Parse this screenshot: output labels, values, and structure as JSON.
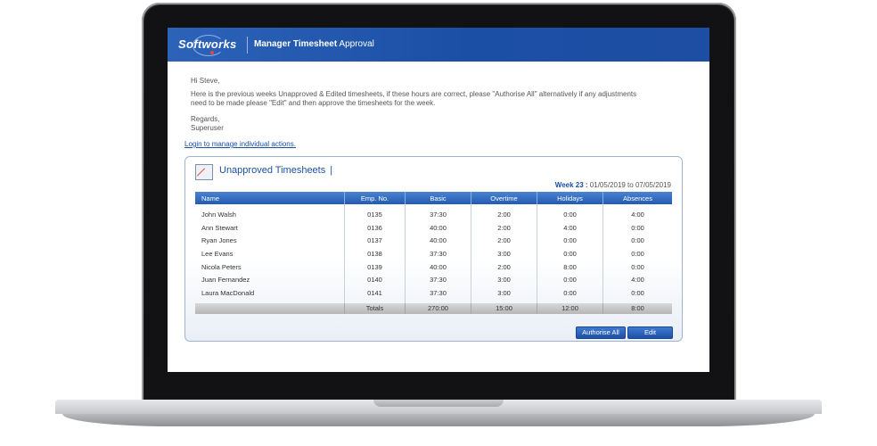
{
  "header": {
    "logo_text": "Softworks",
    "title_bold": "Manager Timesheet",
    "title_rest": " Approval"
  },
  "message": {
    "greeting": "Hi Steve,",
    "body_line1": "Here is the previous weeks Unapproved & Edited timesheets, if these hours are correct, please \"Authorise All\" alternatively if any adjustments",
    "body_line2": "need to be made please \"Edit\" and then approve the timesheets for the week.",
    "regards": "Regards,",
    "signature": "Superuser"
  },
  "login_link": "Login to manage individual actions.",
  "panel": {
    "title": "Unapproved Timesheets",
    "title_separator": "|",
    "week_label": "Week 23 :",
    "week_range": "01/05/2019 to 07/05/2019"
  },
  "table": {
    "columns": [
      "Name",
      "Emp. No.",
      "Basic",
      "Overtime",
      "Holidays",
      "Absences"
    ],
    "rows": [
      [
        "John Walsh",
        "0135",
        "37:30",
        "2:00",
        "0:00",
        "4:00"
      ],
      [
        "Ann Stewart",
        "0136",
        "40:00",
        "2:00",
        "4:00",
        "0:00"
      ],
      [
        "Ryan Jones",
        "0137",
        "40:00",
        "2:00",
        "0:00",
        "0:00"
      ],
      [
        "Lee Evans",
        "0138",
        "37:30",
        "3:00",
        "0:00",
        "0:00"
      ],
      [
        "Nicola Peters",
        "0139",
        "40:00",
        "2:00",
        "8:00",
        "0:00"
      ],
      [
        "Juan Fernandez",
        "0140",
        "37:30",
        "3:00",
        "0:00",
        "4:00"
      ],
      [
        "Laura MacDonald",
        "0141",
        "37:30",
        "3:00",
        "0:00",
        "0:00"
      ]
    ],
    "totals": [
      "",
      "Totals",
      "270:00",
      "15:00",
      "12:00",
      "8:00"
    ]
  },
  "buttons": {
    "authorise_all": "Authorise All",
    "edit": "Edit"
  },
  "colors": {
    "header_blue": "#1b4fa6",
    "link_blue": "#1d4fa3",
    "button_blue": "#1d50a5"
  }
}
